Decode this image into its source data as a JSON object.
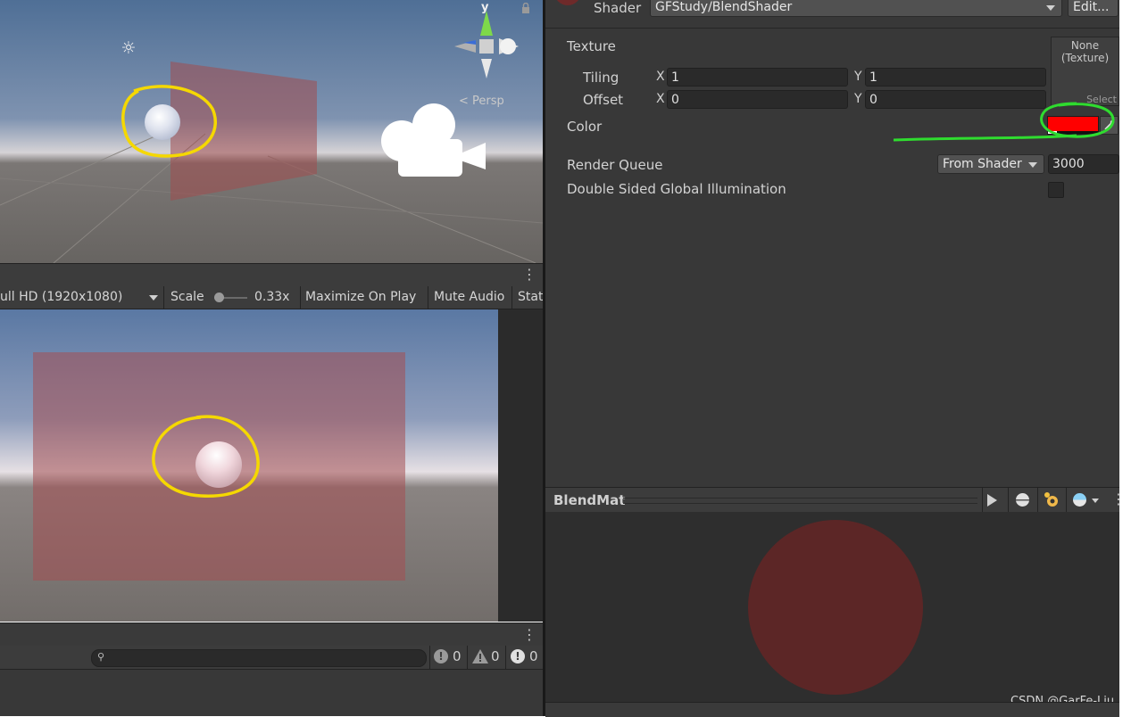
{
  "scene": {
    "gizmo_axis": "y",
    "persp_label": "< Persp",
    "icons": [
      "sun-icon",
      "lock-icon",
      "camera-icon",
      "scene-gizmo-icon"
    ]
  },
  "game": {
    "resolution": "ull HD (1920x1080)",
    "scale_label": "Scale",
    "scale_value": "0.33x",
    "maximize_on_play": "Maximize On Play",
    "mute_audio": "Mute Audio",
    "stats": "Stat"
  },
  "console": {
    "search_placeholder": "",
    "info_count": "0",
    "warning_count": "0",
    "error_count": "0"
  },
  "inspector": {
    "shader_label": "Shader",
    "shader_value": "GFStudy/BlendShader",
    "edit_button": "Edit...",
    "texture_label": "Texture",
    "texture_slot_line1": "None",
    "texture_slot_line2": "(Texture)",
    "texture_select": "Select",
    "tiling_label": "Tiling",
    "tiling_x_label": "X",
    "tiling_x": "1",
    "tiling_y_label": "Y",
    "tiling_y": "1",
    "offset_label": "Offset",
    "offset_x_label": "X",
    "offset_x": "0",
    "offset_y_label": "Y",
    "offset_y": "0",
    "color_label": "Color",
    "color_value": "#ff0000",
    "render_queue_label": "Render Queue",
    "render_queue_mode": "From Shader",
    "render_queue_value": "3000",
    "dsgi_label": "Double Sided Global Illumination",
    "dsgi_checked": false
  },
  "preview": {
    "title": "BlendMat",
    "sphere_color": "#5c2626"
  },
  "watermark": "CSDN @GarFe-Liu",
  "annotation_colors": {
    "yellow": "#f5d800",
    "green": "#2fdc2f"
  }
}
